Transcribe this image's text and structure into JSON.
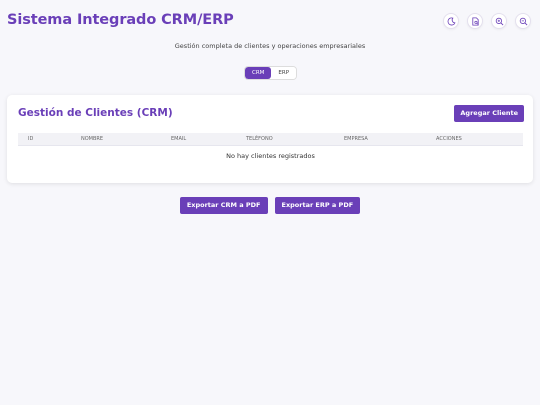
{
  "app": {
    "title": "Sistema Integrado CRM/ERP",
    "subtitle": "Gestión completa de clientes y operaciones empresariales"
  },
  "header_icons": [
    "moon-icon",
    "document-search-icon",
    "zoom-in-icon",
    "zoom-out-icon"
  ],
  "tabs": [
    {
      "label": "CRM",
      "active": true
    },
    {
      "label": "ERP",
      "active": false
    }
  ],
  "crm": {
    "title": "Gestión de Clientes (CRM)",
    "add_label": "Agregar Cliente",
    "columns": [
      "ID",
      "NOMBRE",
      "EMAIL",
      "TELÉFONO",
      "EMPRESA",
      "ACCIONES"
    ],
    "empty_message": "No hay clientes registrados"
  },
  "export": {
    "crm_label": "Exportar CRM a PDF",
    "erp_label": "Exportar ERP a PDF"
  },
  "colors": {
    "accent": "#6a3fb8",
    "background": "#f7f7fb"
  }
}
